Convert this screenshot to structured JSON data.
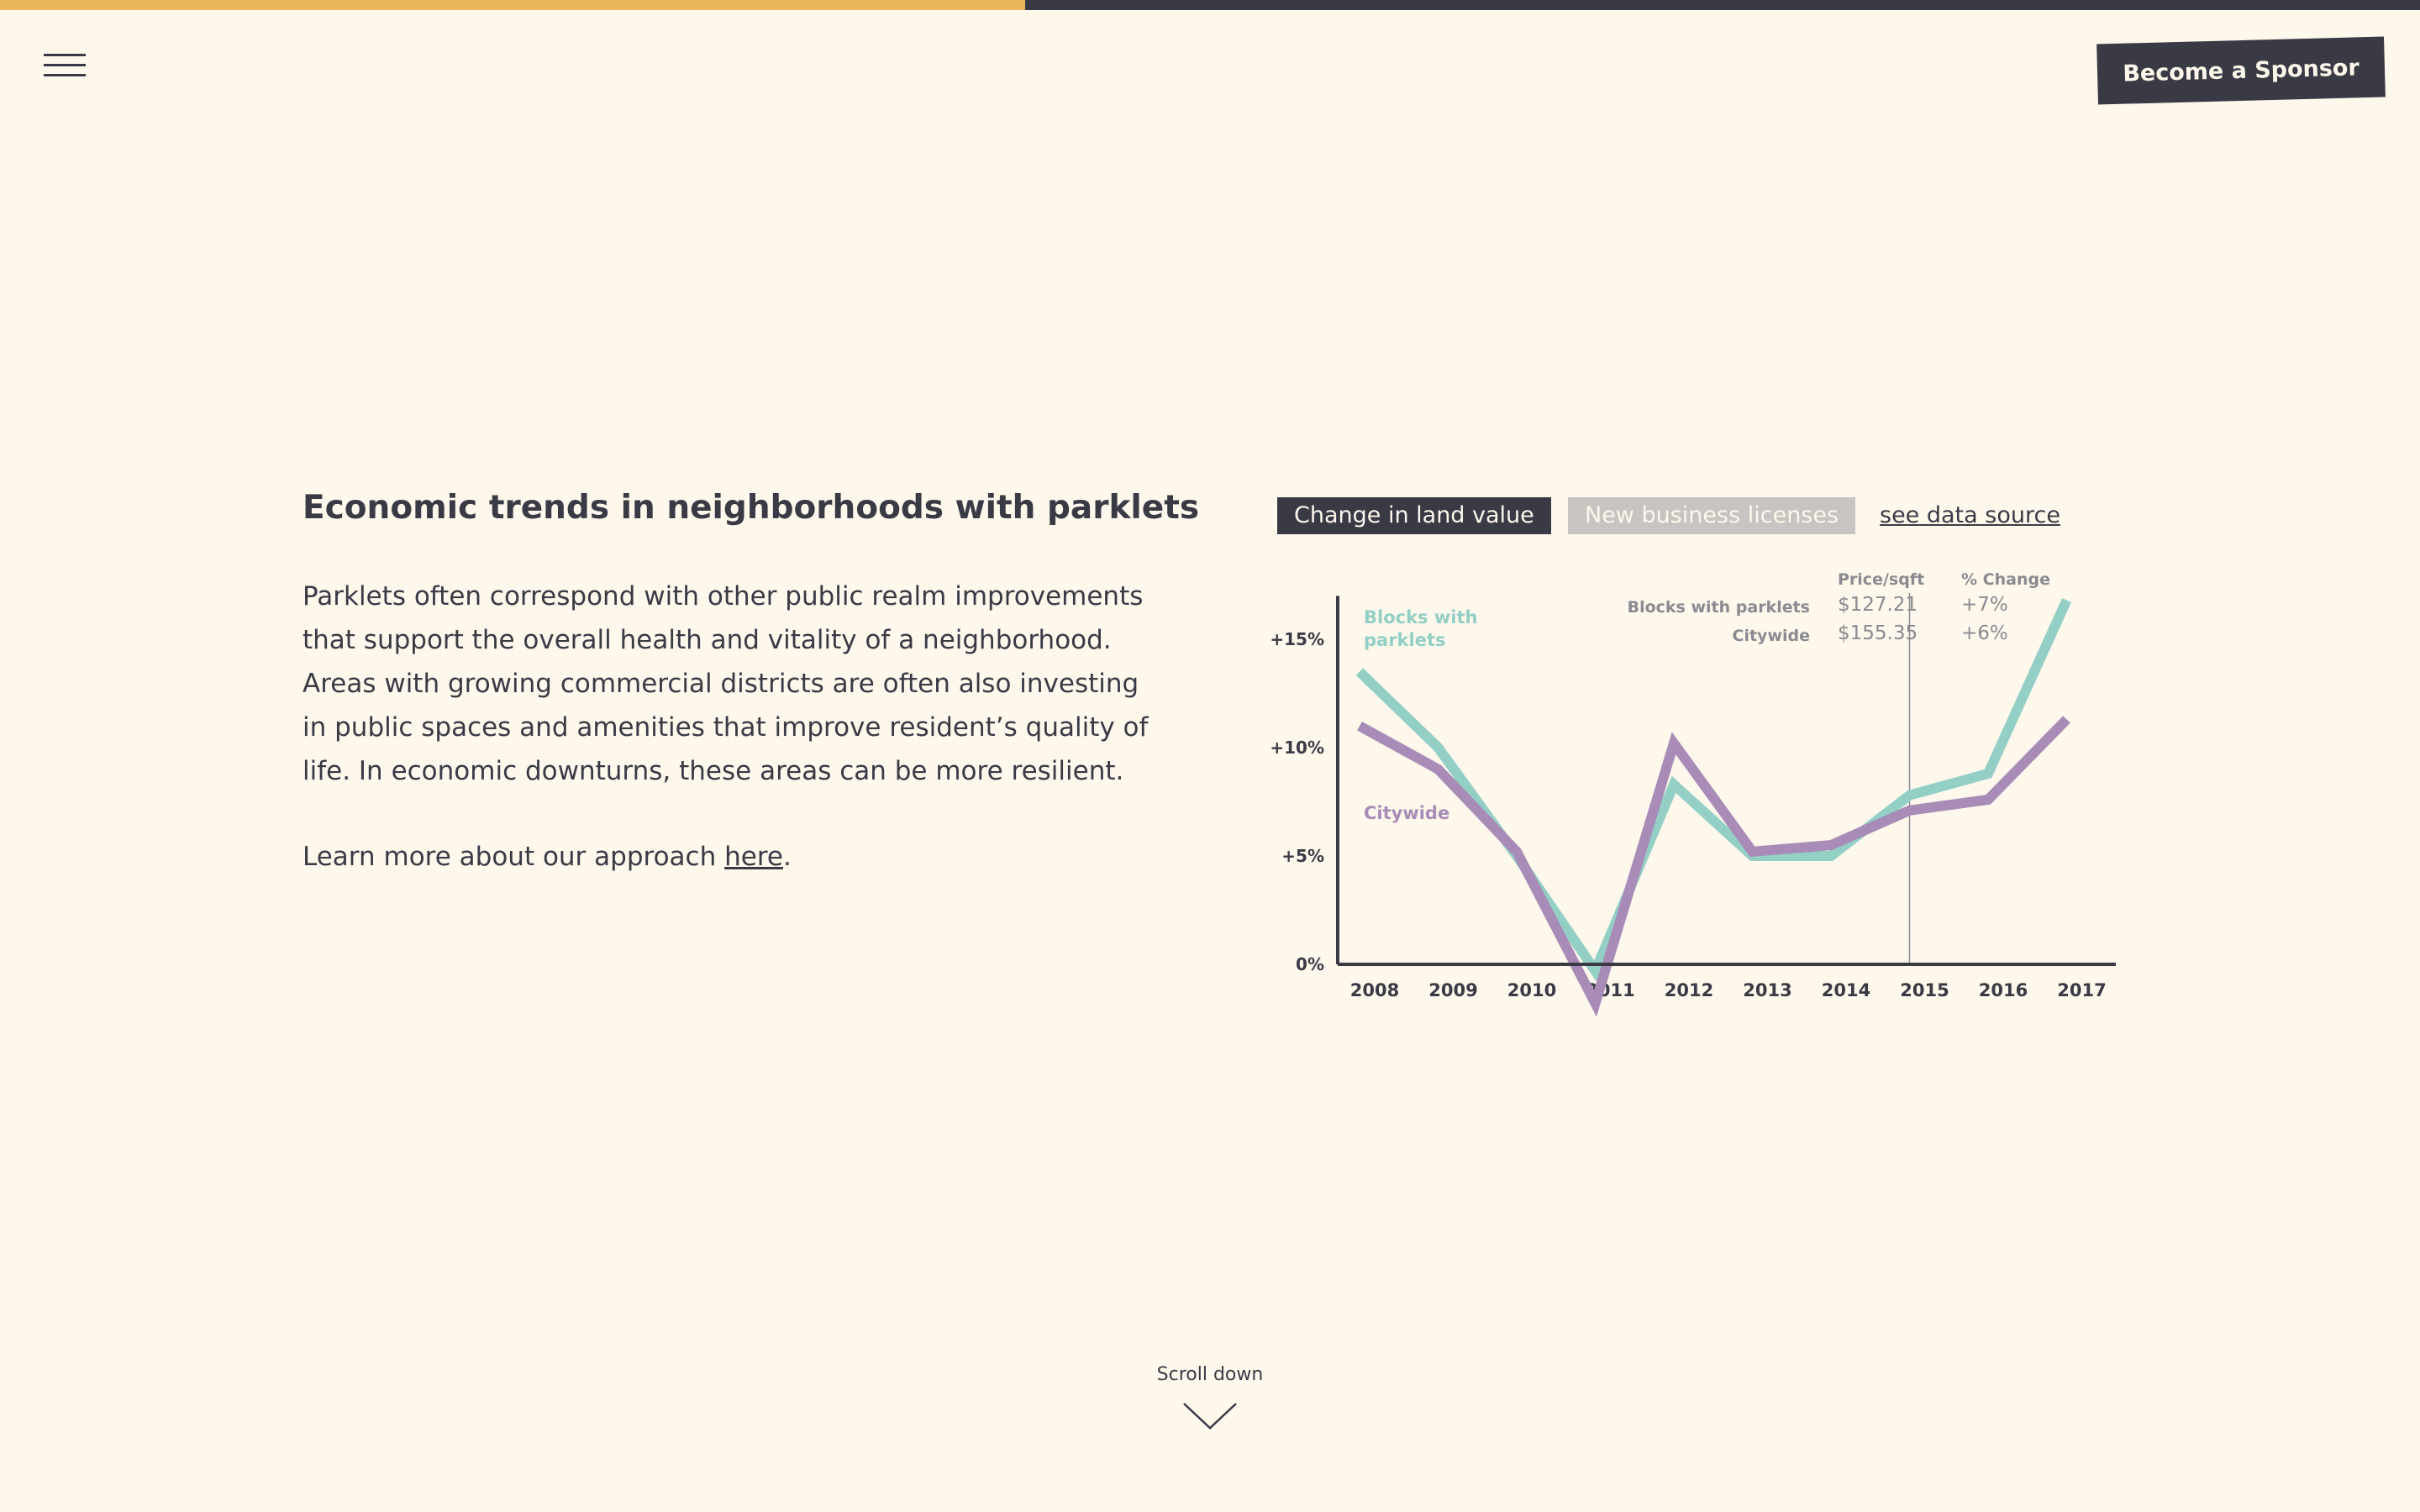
{
  "colors": {
    "background": "#fdf7ec",
    "dark": "#3a3a45",
    "accent": "#e8b658",
    "series_parklets": "#93cfc5",
    "series_citywide": "#a88bb6",
    "tab_inactive": "#c9c3c1"
  },
  "progress": {
    "fraction": 0.4236
  },
  "header": {
    "menu_icon": "hamburger-menu-icon",
    "sponsor_label": "Become a Sponsor"
  },
  "article": {
    "title": "Economic trends in neighborhoods with parklets",
    "body": "Parklets often correspond with other public realm improvements that support the overall health and vitality of a neighborhood. Areas with growing commercial districts are often also investing in public spaces and amenities that improve resident’s quality of life. In economic downturns, these areas can be more resilient.",
    "learn_more_prefix": "Learn more about our approach ",
    "learn_more_link": "here",
    "learn_more_suffix": "."
  },
  "chart_tabs": {
    "active": "Change in land value",
    "inactive": "New business licenses",
    "source_link": "see data source"
  },
  "chart_data": {
    "type": "line",
    "x": [
      "2008",
      "2009",
      "2010",
      "2011",
      "2012",
      "2013",
      "2014",
      "2015",
      "2016",
      "2017"
    ],
    "ylim": [
      0,
      17
    ],
    "yticks": [
      {
        "value": 0,
        "label": "0%"
      },
      {
        "value": 5,
        "label": "+5%"
      },
      {
        "value": 10,
        "label": "+10%"
      },
      {
        "value": 15,
        "label": "+15%"
      }
    ],
    "series": [
      {
        "name": "Blocks with parklets",
        "label_lines": [
          "Blocks with",
          "parklets"
        ],
        "color": "#93cfc5",
        "values": [
          13.5,
          10.0,
          5.0,
          -0.3,
          8.3,
          5.0,
          5.0,
          7.8,
          8.8,
          16.8
        ]
      },
      {
        "name": "Citywide",
        "label_lines": [
          "Citywide"
        ],
        "color": "#a88bb6",
        "values": [
          11.0,
          9.0,
          5.2,
          -1.8,
          10.2,
          5.2,
          5.5,
          7.1,
          7.6,
          11.3
        ]
      }
    ],
    "hover": {
      "year": "2015",
      "columns": [
        "Price/sqft",
        "% Change"
      ],
      "rows": [
        {
          "label": "Blocks with parklets",
          "price": "$127.21",
          "change": "+7%"
        },
        {
          "label": "Citywide",
          "price": "$155.35",
          "change": "+6%"
        }
      ]
    }
  },
  "footer": {
    "scroll_label": "Scroll down",
    "scroll_icon": "chevron-down-icon"
  }
}
